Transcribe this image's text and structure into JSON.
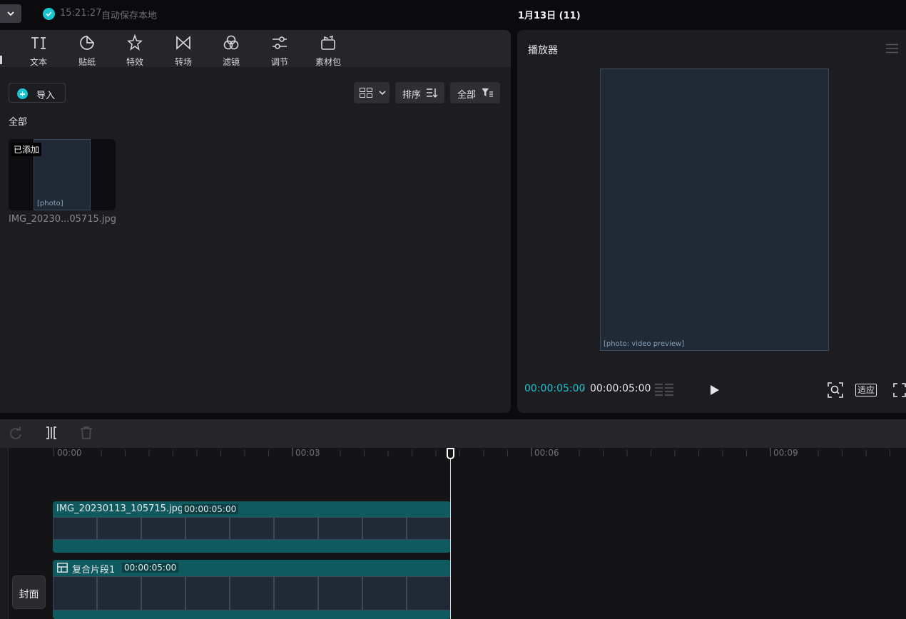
{
  "topbar": {
    "save_time": "15:21:27",
    "save_text": "自动保存本地",
    "project_title": "1月13日 (11)"
  },
  "media_tabs": [
    {
      "label": "文本",
      "icon": "text-icon"
    },
    {
      "label": "贴纸",
      "icon": "sticker-icon"
    },
    {
      "label": "特效",
      "icon": "effects-icon"
    },
    {
      "label": "转场",
      "icon": "transition-icon"
    },
    {
      "label": "滤镜",
      "icon": "filter-icon"
    },
    {
      "label": "调节",
      "icon": "adjust-icon"
    },
    {
      "label": "素材包",
      "icon": "material-pack-icon"
    }
  ],
  "media": {
    "import_label": "导入",
    "sort_label": "排序",
    "filter_label": "全部",
    "section_label": "全部",
    "items": [
      {
        "name": "IMG_20230...05715.jpg",
        "badge": "已添加"
      }
    ]
  },
  "player": {
    "title": "播放器",
    "current_time": "00:00:05:00",
    "separator": "/",
    "total_time": "00:00:05:00",
    "fit_label": "适应"
  },
  "timeline": {
    "ticks": [
      "00:00",
      "00:03",
      "00:06",
      "00:09"
    ],
    "cover_label": "封面",
    "clips": [
      {
        "name": "IMG_20230113_105715.jpg",
        "duration": "00:00:05:00"
      },
      {
        "name": "复合片段1",
        "duration": "00:00:05:00"
      }
    ]
  },
  "colors": {
    "accent": "#19c4cf",
    "clip": "#0e5a5e",
    "panel": "#1d1d21",
    "background": "#0b0b0e"
  }
}
